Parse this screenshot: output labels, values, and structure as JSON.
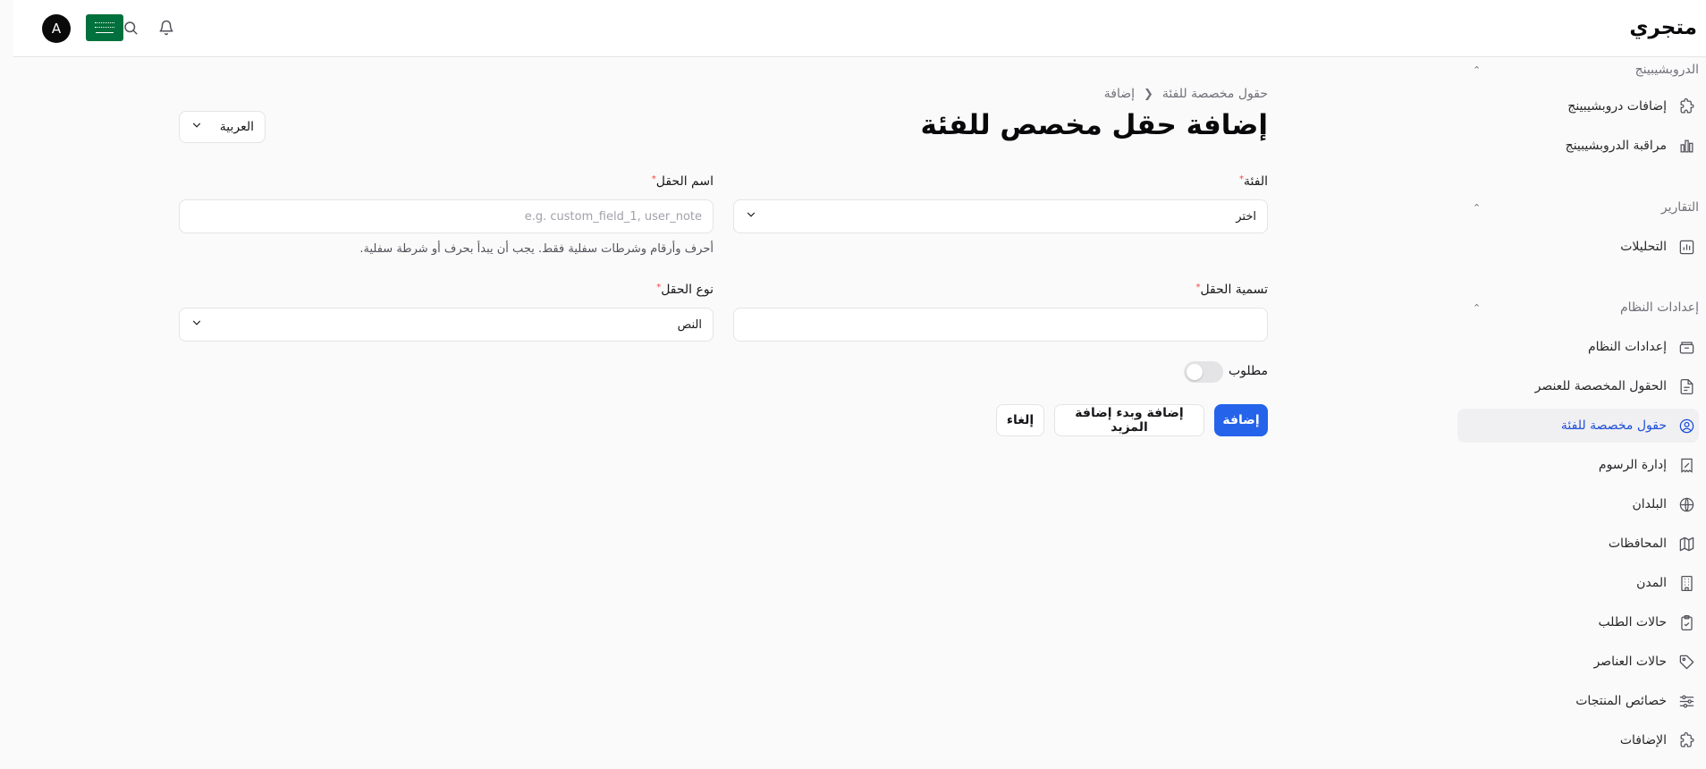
{
  "app": {
    "brand": "متجري",
    "avatar_letter": "A"
  },
  "sidebar": {
    "sections": [
      {
        "title": "الدروبشيبينج",
        "items": [
          {
            "label": "إضافات دروبشيبينج",
            "icon": "puzzle-icon"
          },
          {
            "label": "مراقبة الدروبشيبينج",
            "icon": "bar-chart-icon"
          }
        ]
      },
      {
        "title": "التقارير",
        "items": [
          {
            "label": "التحليلات",
            "icon": "analytics-icon"
          }
        ]
      },
      {
        "title": "إعدادات النظام",
        "items": [
          {
            "label": "إعدادات النظام",
            "icon": "archive-icon"
          },
          {
            "label": "الحقول المخصصة للعنصر",
            "icon": "file-text-icon"
          },
          {
            "label": "حقول مخصصة للفئة",
            "icon": "user-circle-icon",
            "active": true
          },
          {
            "label": "إدارة الرسوم",
            "icon": "receipt-percent-icon"
          },
          {
            "label": "البلدان",
            "icon": "globe-icon"
          },
          {
            "label": "المحافظات",
            "icon": "map-icon"
          },
          {
            "label": "المدن",
            "icon": "building-icon"
          },
          {
            "label": "حالات الطلب",
            "icon": "clipboard-check-icon"
          },
          {
            "label": "حالات العناصر",
            "icon": "tag-icon"
          },
          {
            "label": "خصائص المنتجات",
            "icon": "sliders-icon"
          },
          {
            "label": "الإضافات",
            "icon": "puzzle-icon"
          }
        ]
      }
    ]
  },
  "breadcrumb": {
    "parent": "حقول مخصصة للفئة",
    "current": "إضافة"
  },
  "page": {
    "title": "إضافة حقل مخصص للفئة",
    "language": "العربية"
  },
  "form": {
    "category_label": "الفئة",
    "category_value": "اختر",
    "field_name_label": "اسم الحقل",
    "field_name_placeholder": "e.g. custom_field_1, user_note",
    "field_name_hint": "أحرف وأرقام وشرطات سفلية فقط. يجب أن يبدأ بحرف أو شرطة سفلية.",
    "field_label_label": "تسمية الحقل",
    "field_label_value": "",
    "field_type_label": "نوع الحقل",
    "field_type_value": "النص",
    "required_label": "مطلوب",
    "required_on": false
  },
  "buttons": {
    "add": "إضافة",
    "add_more": "إضافة وبدء إضافة المزيد",
    "cancel": "إلغاء"
  },
  "colors": {
    "primary": "#2563eb",
    "active_text": "#1d4ed8",
    "required": "#ef4444",
    "flag": "#00703c"
  }
}
